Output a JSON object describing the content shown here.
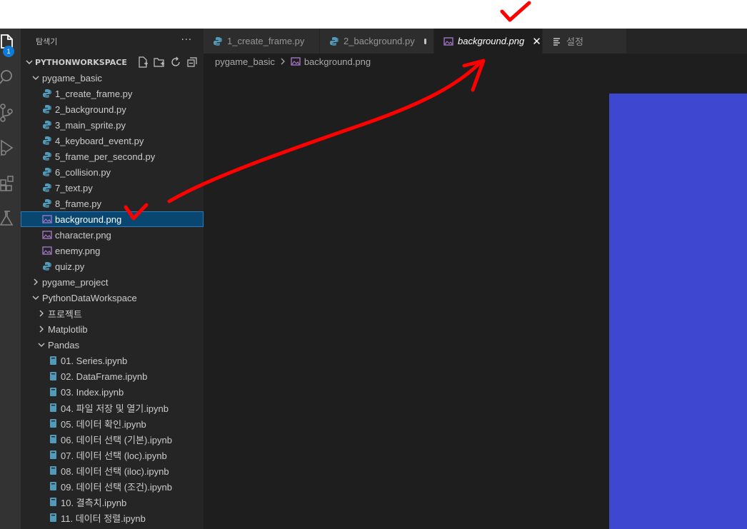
{
  "sidebar": {
    "title": "탐색기",
    "more": "···",
    "workspace_title": "PYTHONWORKSPACE",
    "badge": "1",
    "tree": [
      {
        "label": "pygame_basic",
        "indent": 1,
        "type": "folder",
        "expanded": true
      },
      {
        "label": "1_create_frame.py",
        "indent": 2,
        "type": "py"
      },
      {
        "label": "2_background.py",
        "indent": 2,
        "type": "py"
      },
      {
        "label": "3_main_sprite.py",
        "indent": 2,
        "type": "py"
      },
      {
        "label": "4_keyboard_event.py",
        "indent": 2,
        "type": "py"
      },
      {
        "label": "5_frame_per_second.py",
        "indent": 2,
        "type": "py"
      },
      {
        "label": "6_collision.py",
        "indent": 2,
        "type": "py"
      },
      {
        "label": "7_text.py",
        "indent": 2,
        "type": "py"
      },
      {
        "label": "8_frame.py",
        "indent": 2,
        "type": "py"
      },
      {
        "label": "background.png",
        "indent": 2,
        "type": "png",
        "selected": true
      },
      {
        "label": "character.png",
        "indent": 2,
        "type": "png"
      },
      {
        "label": "enemy.png",
        "indent": 2,
        "type": "png"
      },
      {
        "label": "quiz.py",
        "indent": 2,
        "type": "py"
      },
      {
        "label": "pygame_project",
        "indent": 1,
        "type": "folder",
        "expanded": false
      },
      {
        "label": "PythonDataWorkspace",
        "indent": 1,
        "type": "folder",
        "expanded": true
      },
      {
        "label": "프로젝트",
        "indent": 2,
        "type": "folder",
        "expanded": false
      },
      {
        "label": "Matplotlib",
        "indent": 2,
        "type": "folder",
        "expanded": false
      },
      {
        "label": "Pandas",
        "indent": 2,
        "type": "folder",
        "expanded": true
      },
      {
        "label": "01. Series.ipynb",
        "indent": 3,
        "type": "nb"
      },
      {
        "label": "02. DataFrame.ipynb",
        "indent": 3,
        "type": "nb"
      },
      {
        "label": "03. Index.ipynb",
        "indent": 3,
        "type": "nb"
      },
      {
        "label": "04. 파일 저장 및 열기.ipynb",
        "indent": 3,
        "type": "nb"
      },
      {
        "label": "05. 데이터 확인.ipynb",
        "indent": 3,
        "type": "nb"
      },
      {
        "label": "06. 데이터 선택 (기본).ipynb",
        "indent": 3,
        "type": "nb"
      },
      {
        "label": "07. 데이터 선택 (loc).ipynb",
        "indent": 3,
        "type": "nb"
      },
      {
        "label": "08. 데이터 선택 (iloc).ipynb",
        "indent": 3,
        "type": "nb"
      },
      {
        "label": "09. 데이터 선택 (조건).ipynb",
        "indent": 3,
        "type": "nb"
      },
      {
        "label": "10. 결측치.ipynb",
        "indent": 3,
        "type": "nb"
      },
      {
        "label": "11. 데이터 정렬.ipynb",
        "indent": 3,
        "type": "nb"
      }
    ]
  },
  "tabs": [
    {
      "label": "1_create_frame.py",
      "icon": "python-icon",
      "active": false,
      "dirty": false
    },
    {
      "label": "2_background.py",
      "icon": "python-icon",
      "active": false,
      "dirty": true
    },
    {
      "label": "background.png",
      "icon": "image-icon",
      "active": true,
      "dirty": false
    },
    {
      "label": "설정",
      "icon": "settings-list-icon",
      "active": false,
      "dirty": false
    }
  ],
  "breadcrumb": {
    "folder": "pygame_basic",
    "file": "background.png"
  },
  "colors": {
    "image_fill": "#3d47cf",
    "annotation": "#ff0000",
    "python_icon": "#519aba",
    "image_icon": "#a074c4",
    "notebook_icon": "#519aba"
  }
}
